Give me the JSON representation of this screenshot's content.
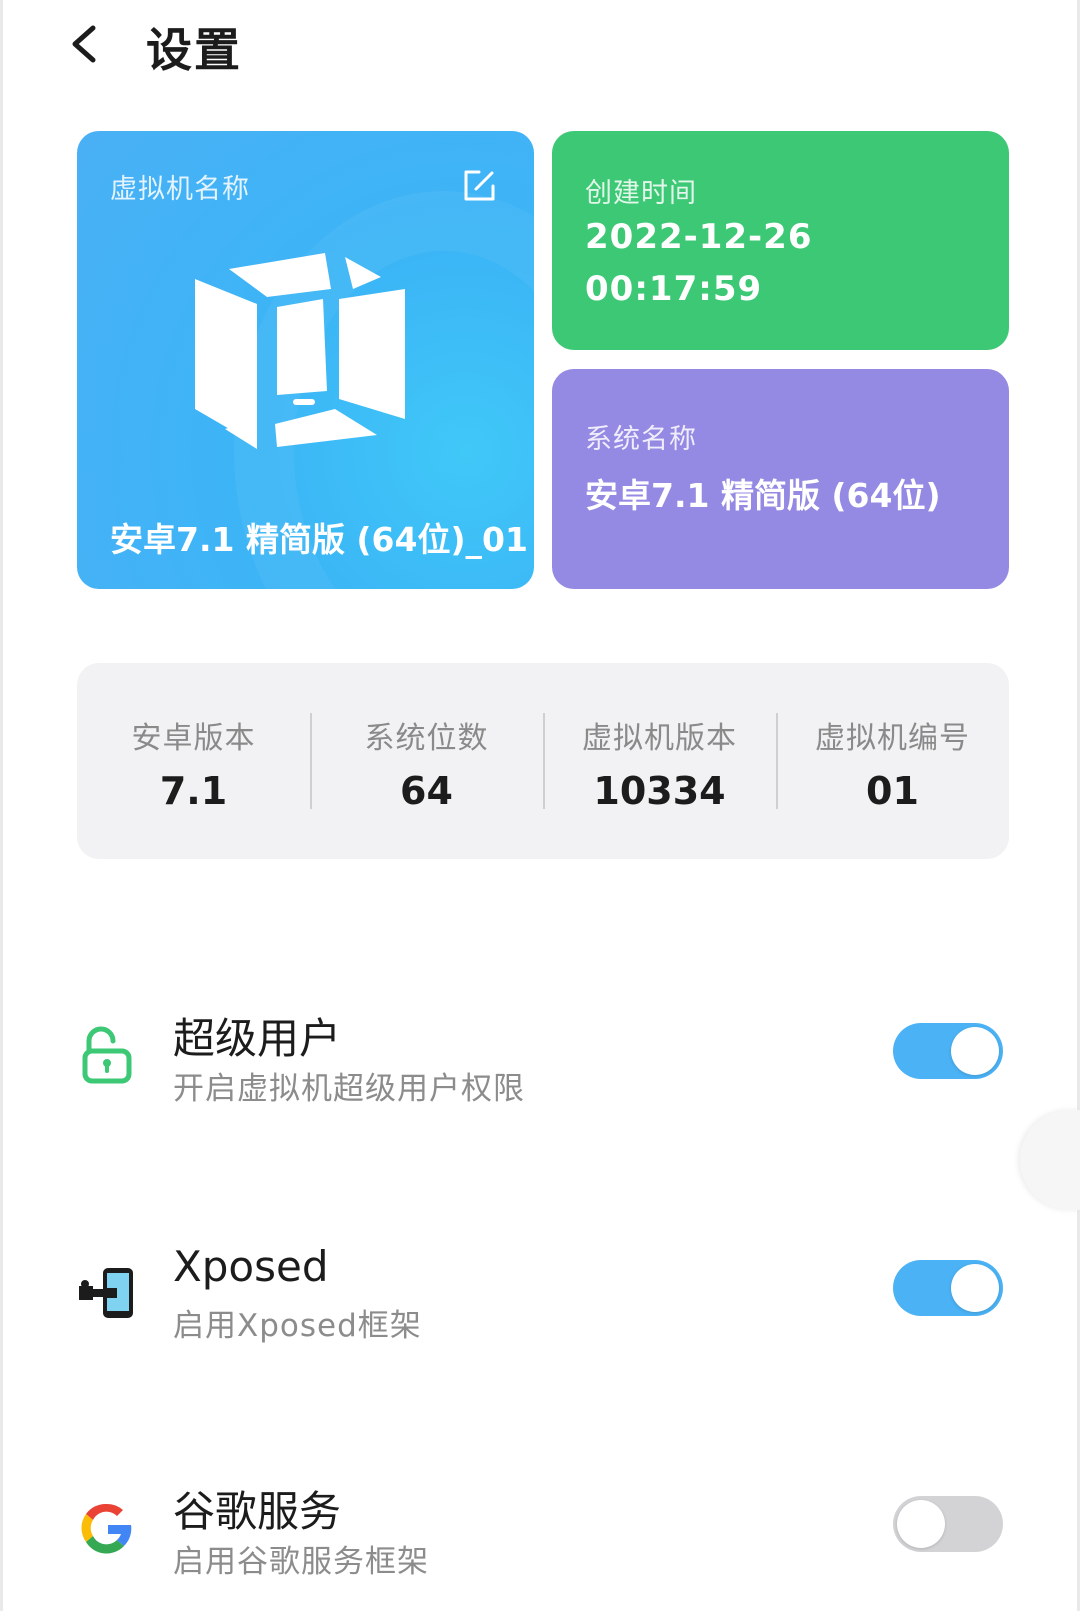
{
  "header": {
    "title": "设置"
  },
  "vm_card": {
    "label": "虚拟机名称",
    "name": "安卓7.1 精简版 (64位)_01"
  },
  "time_card": {
    "label": "创建时间",
    "date": "2022-12-26",
    "time": "00:17:59"
  },
  "sys_card": {
    "label": "系统名称",
    "name": "安卓7.1 精简版 (64位)"
  },
  "stats": [
    {
      "label": "安卓版本",
      "value": "7.1"
    },
    {
      "label": "系统位数",
      "value": "64"
    },
    {
      "label": "虚拟机版本",
      "value": "10334"
    },
    {
      "label": "虚拟机编号",
      "value": "01"
    }
  ],
  "settings": [
    {
      "title": "超级用户",
      "subtitle": "开启虚拟机超级用户权限",
      "enabled": true,
      "icon": "unlock-icon"
    },
    {
      "title": "Xposed",
      "subtitle": "启用Xposed框架",
      "enabled": true,
      "icon": "xposed-icon"
    },
    {
      "title": "谷歌服务",
      "subtitle": "启用谷歌服务框架",
      "enabled": false,
      "icon": "google-icon"
    }
  ],
  "colors": {
    "vm_card": "#3bb5f6",
    "time_card": "#3cc874",
    "sys_card": "#9489e3",
    "toggle_on": "#4bb2f5",
    "toggle_off": "#d3d3d6"
  }
}
